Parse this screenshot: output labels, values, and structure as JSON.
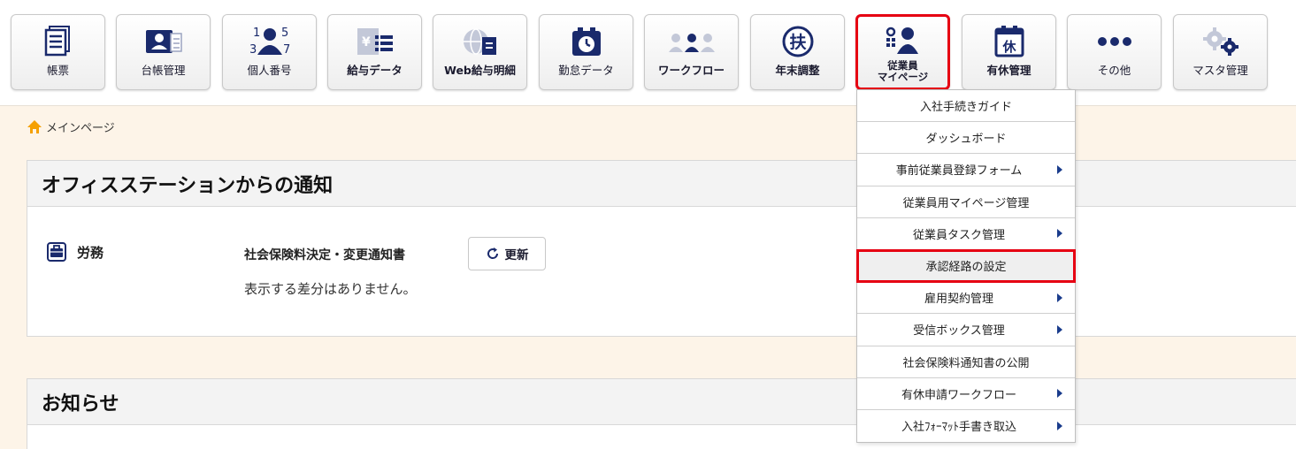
{
  "toolbar": {
    "buttons": [
      {
        "label": "帳票",
        "icon": "document-icon"
      },
      {
        "label": "台帳管理",
        "icon": "id-card-icon"
      },
      {
        "label": "個人番号",
        "icon": "number-person-icon"
      },
      {
        "label": "給与データ",
        "icon": "salary-data-icon"
      },
      {
        "label": "Web給与明細",
        "icon": "web-payslip-icon"
      },
      {
        "label": "勤怠データ",
        "icon": "attendance-clock-icon"
      },
      {
        "label": "ワークフロー",
        "icon": "workflow-people-icon"
      },
      {
        "label": "年末調整",
        "icon": "fu-circle-icon"
      },
      {
        "label_line1": "従業員",
        "label_line2": "マイページ",
        "icon": "employee-mypage-icon"
      },
      {
        "label": "有休管理",
        "icon": "calendar-leave-icon",
        "icon_char": "休"
      },
      {
        "label": "その他",
        "icon": "more-dots-icon"
      },
      {
        "label": "マスタ管理",
        "icon": "gears-icon"
      }
    ],
    "accent_color": "#1a2a6c",
    "active_border_color": "#e60012"
  },
  "breadcrumb": {
    "label": "メインページ"
  },
  "notice_panel": {
    "title": "オフィスステーションからの通知",
    "category": "労務",
    "notice_title": "社会保険料決定・変更通知書",
    "refresh_label": "更新",
    "body": "表示する差分はありません。"
  },
  "info_panel": {
    "title": "お知らせ"
  },
  "dropdown": {
    "items": [
      {
        "label": "入社手続きガイド",
        "submenu": false
      },
      {
        "label": "ダッシュボード",
        "submenu": false
      },
      {
        "label": "事前従業員登録フォーム",
        "submenu": true
      },
      {
        "label": "従業員用マイページ管理",
        "submenu": false
      },
      {
        "label": "従業員タスク管理",
        "submenu": true
      },
      {
        "label": "承認経路の設定",
        "submenu": false,
        "highlight": true
      },
      {
        "label": "雇用契約管理",
        "submenu": true
      },
      {
        "label": "受信ボックス管理",
        "submenu": true
      },
      {
        "label": "社会保険料通知書の公開",
        "submenu": false
      },
      {
        "label": "有休申請ワークフロー",
        "submenu": true
      },
      {
        "label": "入社ﾌｫｰﾏｯﾄ手書き取込",
        "submenu": true
      }
    ]
  }
}
